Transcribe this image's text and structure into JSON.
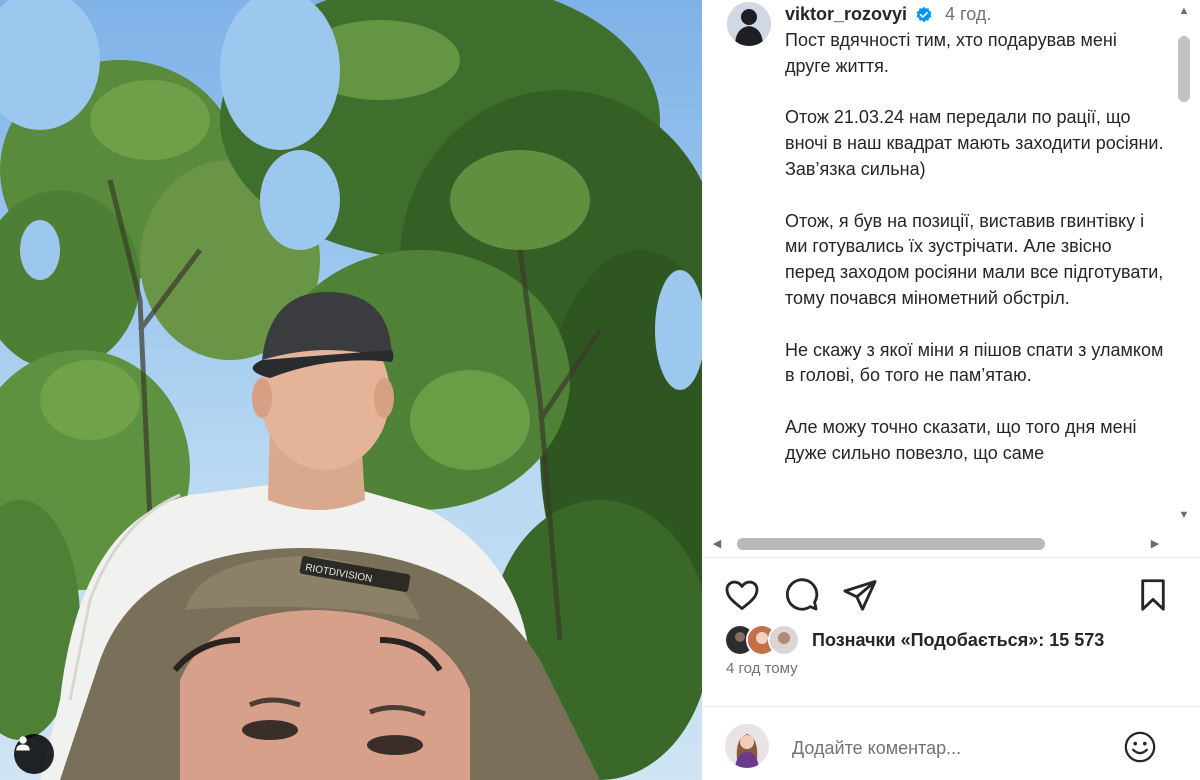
{
  "post": {
    "username": "viktor_rozovyi",
    "time": "4 год.",
    "caption": [
      "Пост вдячності тим, хто подарував мені друге життя.",
      "Отож 21.03.24 нам передали по рації, що вночі в наш квадрат мають заходити росіяни. Зав’язка сильна)",
      "Отож, я був на позиції, виставив гвинтівку і ми готувались їх зустрічати. Але звісно перед заходом росіяни мали все підготувати, тому почався мінометний обстріл.",
      "Не скажу з якої міни я пішов спати з уламком в голові, бо того не пам’ятаю.",
      "Але можу точно сказати, що того дня мені дуже сильно повезло, що саме"
    ],
    "likes_text": "Позначки «Подобається»: 15 573",
    "posted_ago": "4 год тому",
    "cap_print": "RIOTDIVISION"
  },
  "comment": {
    "placeholder": "Додайте коментар..."
  },
  "icons": {
    "like": "heart-icon",
    "comment": "comment-bubble-icon",
    "share": "paper-plane-icon",
    "save": "bookmark-icon",
    "emoji": "smiley-icon",
    "tagged_users": "person-icon",
    "verified": "verified-badge-icon"
  },
  "colors": {
    "text": "#262626",
    "secondary": "#737373",
    "verified": "#0095f6",
    "sky": "#8dbceb",
    "foliage": "#3d6a2a"
  }
}
